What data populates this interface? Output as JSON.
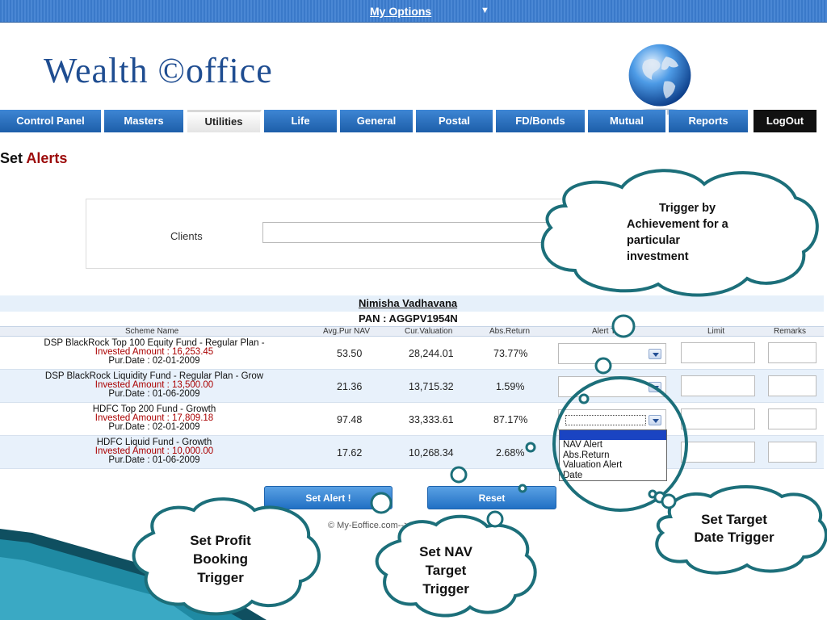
{
  "topbar": {
    "my_options": "My Options",
    "caret": "▼"
  },
  "header": {
    "logo": "Wealth ©office"
  },
  "nav": {
    "tabs": [
      "Control Panel",
      "Masters",
      "Utilities",
      "Life",
      "General",
      "Postal",
      "FD/Bonds",
      "Mutual",
      "Reports",
      "LogOut"
    ],
    "active": "Utilities"
  },
  "page": {
    "title_prefix": "Set",
    "title_accent": "Alerts"
  },
  "filter": {
    "clients_label": "Clients",
    "clients_value": ""
  },
  "client": {
    "name": "Nimisha Vadhavana",
    "pan": "PAN : AGGPV1954N"
  },
  "table": {
    "headers": [
      "Scheme Name",
      "Avg.Pur NAV",
      "Cur.Valuation",
      "Abs.Return",
      "Alert Type",
      "Limit",
      "Remarks"
    ],
    "rows": [
      {
        "scheme": "DSP BlackRock Top 100 Equity Fund - Regular Plan -",
        "invested": "Invested Amount : 16,253.45",
        "pur_date": "Pur.Date : 02-01-2009",
        "nav": "53.50",
        "valuation": "28,244.01",
        "return": "73.77%"
      },
      {
        "scheme": "DSP BlackRock Liquidity Fund - Regular Plan - Grow",
        "invested": "Invested Amount : 13,500.00",
        "pur_date": "Pur.Date : 01-06-2009",
        "nav": "21.36",
        "valuation": "13,715.32",
        "return": "1.59%"
      },
      {
        "scheme": "HDFC Top 200 Fund - Growth",
        "invested": "Invested Amount : 17,809.18",
        "pur_date": "Pur.Date : 02-01-2009",
        "nav": "97.48",
        "valuation": "33,333.61",
        "return": "87.17%"
      },
      {
        "scheme": "HDFC Liquid Fund - Growth",
        "invested": "Invested Amount : 10,000.00",
        "pur_date": "Pur.Date : 01-06-2009",
        "nav": "17.62",
        "valuation": "10,268.34",
        "return": "2.68%"
      }
    ]
  },
  "alert_options": [
    "NAV Alert",
    "Abs.Return",
    "Valuation Alert",
    "Date"
  ],
  "buttons": {
    "set_alert": "Set Alert !",
    "reset": "Reset"
  },
  "footer": "© My-Eoffice.com--> Advisor Sectio",
  "callouts": {
    "achievement": [
      "Trigger by",
      "Achievement for a",
      "particular",
      "investment"
    ],
    "target_date": [
      "Set Target",
      "Date Trigger"
    ],
    "profit_booking": [
      "Set Profit",
      "Booking",
      "Trigger"
    ],
    "nav_target": [
      "Set NAV",
      "Target",
      "Trigger"
    ]
  },
  "colors": {
    "nav_blue": "#1d5ea9",
    "accent_red": "#9c0b0b",
    "amount_red": "#aa0000",
    "cloud_stroke": "#1c6f7a"
  }
}
